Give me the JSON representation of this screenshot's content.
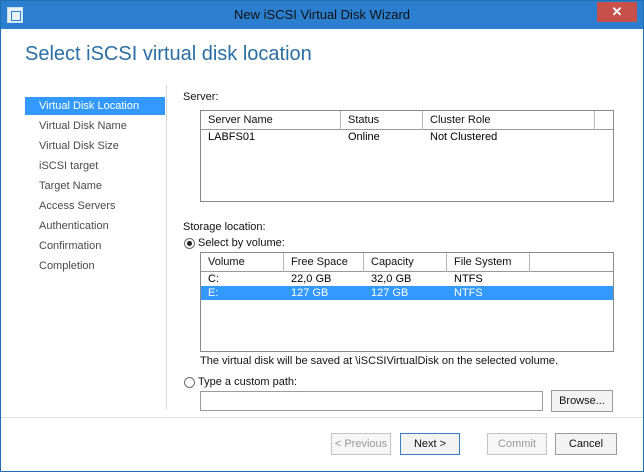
{
  "window": {
    "title": "New iSCSI Virtual Disk Wizard",
    "close_glyph": "✕"
  },
  "page": {
    "heading": "Select iSCSI virtual disk location"
  },
  "sidebar": {
    "items": [
      {
        "label": "Virtual Disk Location",
        "active": true
      },
      {
        "label": "Virtual Disk Name"
      },
      {
        "label": "Virtual Disk Size"
      },
      {
        "label": "iSCSI target"
      },
      {
        "label": "Target Name"
      },
      {
        "label": "Access Servers"
      },
      {
        "label": "Authentication"
      },
      {
        "label": "Confirmation"
      },
      {
        "label": "Completion"
      }
    ]
  },
  "server": {
    "section_label": "Server:",
    "columns": [
      "Server Name",
      "Status",
      "Cluster Role"
    ],
    "rows": [
      {
        "name": "LABFS01",
        "status": "Online",
        "cluster_role": "Not Clustered"
      }
    ]
  },
  "storage": {
    "section_label": "Storage location:",
    "select_by_volume_label": "Select by volume:",
    "columns": [
      "Volume",
      "Free Space",
      "Capacity",
      "File System"
    ],
    "rows": [
      {
        "volume": "C:",
        "free_space": "22,0 GB",
        "capacity": "32,0 GB",
        "file_system": "NTFS",
        "selected": false
      },
      {
        "volume": "E:",
        "free_space": "127 GB",
        "capacity": "127 GB",
        "file_system": "NTFS",
        "selected": true
      }
    ],
    "save_note": "The virtual disk will be saved at \\iSCSIVirtualDisk on the selected volume.",
    "custom_path_label": "Type a custom path:",
    "custom_path_value": "",
    "browse_label": "Browse...",
    "selected_option": "Select by volume"
  },
  "footer": {
    "previous_label": "< Previous",
    "next_label": "Next >",
    "commit_label": "Commit",
    "cancel_label": "Cancel"
  },
  "colors": {
    "accent": "#3399ff",
    "titlebar": "#2b7fce",
    "heading": "#2a6ea6",
    "close": "#c7504b"
  }
}
